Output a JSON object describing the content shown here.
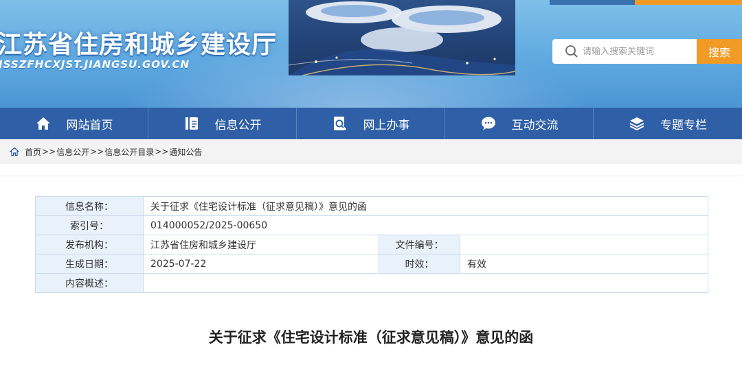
{
  "header": {
    "site_title": "江苏省住房和城乡建设厅",
    "site_url": "JSSZFHCXJST.JIANGSU.GOV.CN",
    "search": {
      "placeholder": "请输入搜索关键词",
      "button_label": "搜索"
    }
  },
  "nav": {
    "items": [
      {
        "label": "网站首页",
        "icon": "home-icon"
      },
      {
        "label": "信息公开",
        "icon": "document-icon"
      },
      {
        "label": "网上办事",
        "icon": "search-doc-icon"
      },
      {
        "label": "互动交流",
        "icon": "chat-icon"
      },
      {
        "label": "专题专栏",
        "icon": "layers-icon"
      }
    ]
  },
  "breadcrumb": {
    "items": [
      "首页",
      "信息公开",
      "信息公开目录",
      "通知公告"
    ],
    "separator": ">>"
  },
  "info": {
    "name_label": "信息名称：",
    "name_value": "关于征求《住宅设计标准（征求意见稿）》意见的函",
    "index_label": "索引号：",
    "index_value": "014000052/2025-00650",
    "publisher_label": "发布机构：",
    "publisher_value": "江苏省住房和城乡建设厅",
    "doc_no_label": "文件编号：",
    "doc_no_value": "",
    "date_label": "生成日期：",
    "date_value": "2025-07-22",
    "validity_label": "时效：",
    "validity_value": "有效",
    "summary_label": "内容概述：",
    "summary_value": ""
  },
  "article": {
    "title": "关于征求《住宅设计标准（征求意见稿）》意见的函"
  },
  "colors": {
    "header_blue": "#5fa9e0",
    "nav_blue": "#2f5fa6",
    "accent_orange": "#f19a24",
    "table_label_bg": "#e9f1fa"
  }
}
